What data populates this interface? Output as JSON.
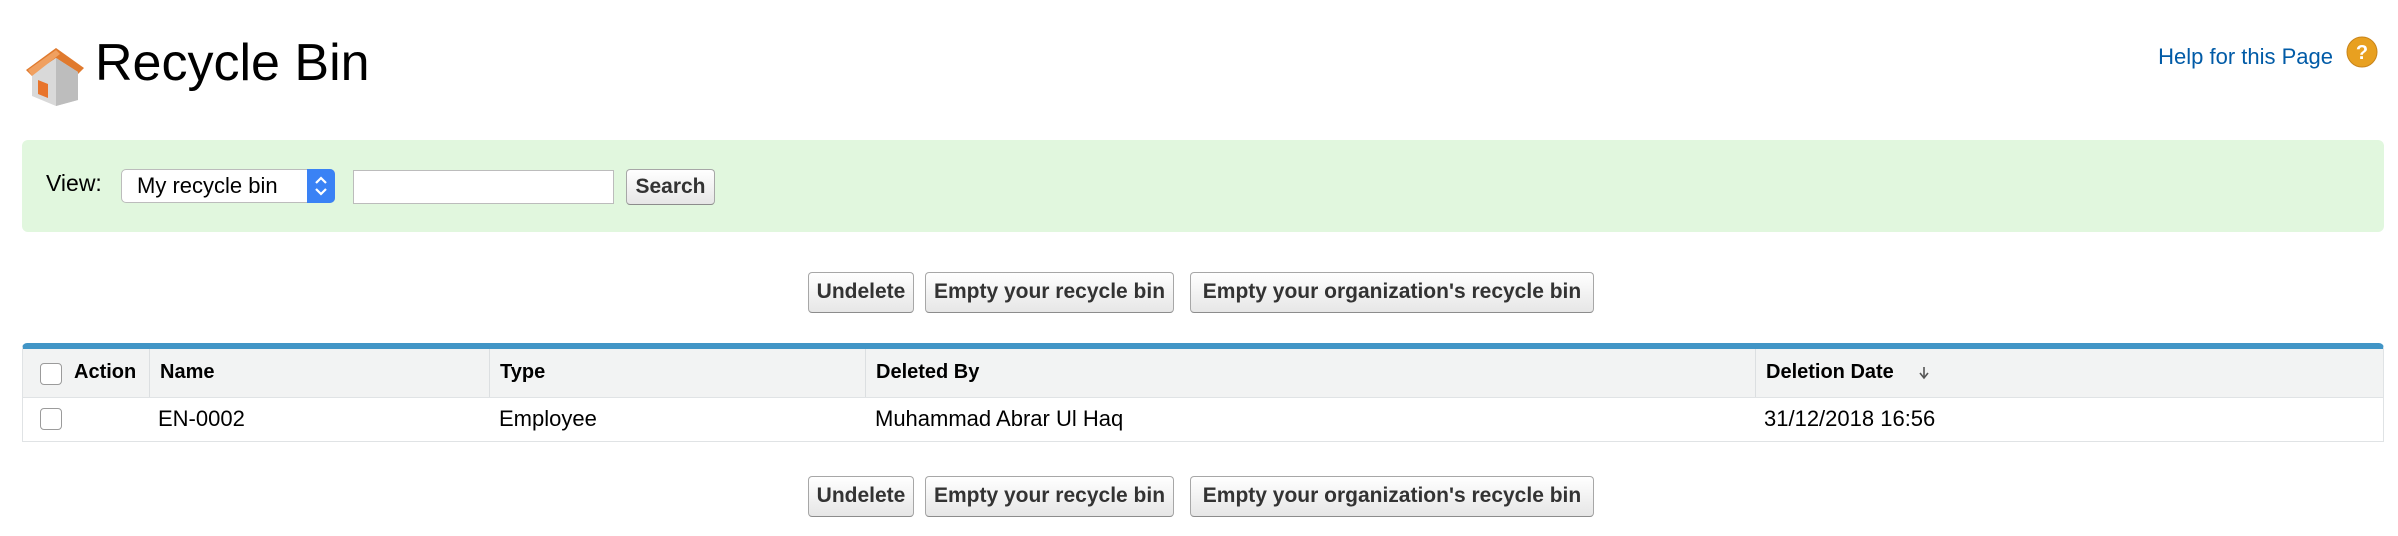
{
  "header": {
    "title": "Recycle Bin",
    "help_link": "Help for this Page",
    "icon": "house-icon",
    "help_icon": "question-mark-icon"
  },
  "filter": {
    "view_label": "View:",
    "selected_view": "My recycle bin",
    "search_value": "",
    "search_button": "Search",
    "background_color": "#e1f7de"
  },
  "actions": {
    "undelete": "Undelete",
    "empty_mine": "Empty your recycle bin",
    "empty_org": "Empty your organization's recycle bin"
  },
  "table": {
    "accent_color": "#4195c6",
    "columns": {
      "action": "Action",
      "name": "Name",
      "type": "Type",
      "deleted_by": "Deleted By",
      "deletion_date": "Deletion Date"
    },
    "sort_icon": "arrow-down-icon",
    "rows": [
      {
        "name": "EN-0002",
        "type": "Employee",
        "deleted_by": "Muhammad Abrar Ul Haq",
        "deletion_date": "31/12/2018 16:56"
      }
    ]
  }
}
